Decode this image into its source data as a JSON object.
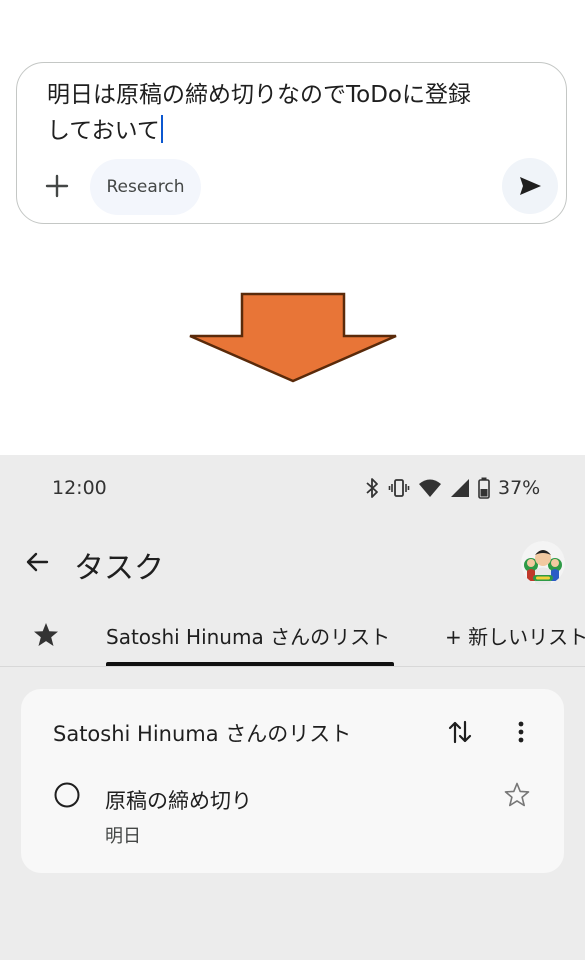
{
  "composer": {
    "text": "明日は原稿の締め切りなのでToDoに登録\nしておいて",
    "research_label": "Research",
    "icons": {
      "add": "plus-icon",
      "send": "send-icon"
    }
  },
  "arrow": {
    "color": "#e87537",
    "outline": "#5a2a0a",
    "icon": "down-arrow-icon"
  },
  "status_bar": {
    "time": "12:00",
    "battery": "37%",
    "icons": [
      "bluetooth-icon",
      "vibrate-icon",
      "wifi-icon",
      "signal-icon",
      "battery-icon"
    ]
  },
  "app_bar": {
    "title": "タスク",
    "icons": {
      "back": "back-arrow-icon",
      "avatar": "avatar"
    }
  },
  "tabs": {
    "starred_icon": "star-icon",
    "items": [
      {
        "label": "Satoshi Hinuma さんのリスト",
        "selected": true
      },
      {
        "label": "+ 新しいリスト",
        "selected": false
      }
    ]
  },
  "list_card": {
    "title": "Satoshi Hinuma さんのリスト",
    "icons": {
      "sort": "sort-icon",
      "more": "more-vert-icon"
    },
    "tasks": [
      {
        "title": "原稿の締め切り",
        "due": "明日",
        "starred": false
      }
    ]
  },
  "colors": {
    "accent": "#0b57d0",
    "phone_bg": "#ececec",
    "card_bg": "#f8f8f8",
    "chip_bg": "#f3f6fc"
  }
}
